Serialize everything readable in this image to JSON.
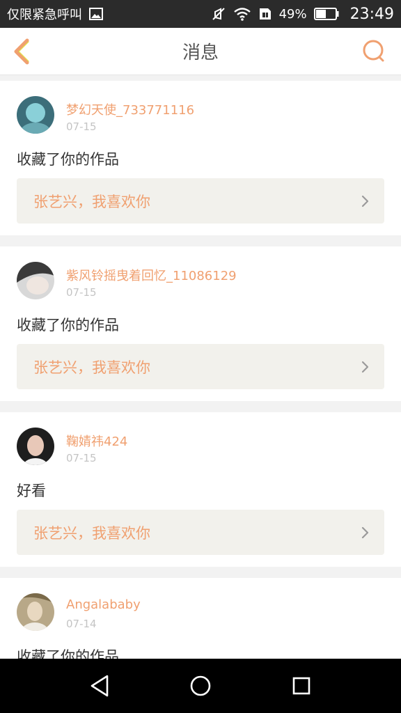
{
  "status_bar": {
    "carrier_text": "仅限紧急呼叫",
    "battery_percent": "49%",
    "time": "23:49",
    "icons": [
      "image-icon",
      "mute-icon",
      "wifi-icon",
      "sim-icon",
      "battery-icon"
    ]
  },
  "header": {
    "title": "消息",
    "back_icon": "chevron-left-icon",
    "search_icon": "search-icon",
    "accent_color": "#f0a070"
  },
  "messages": [
    {
      "username": "梦幻天使_733771116",
      "date": "07-15",
      "action": "收藏了你的作品",
      "work_title": "张艺兴，我喜欢你",
      "avatar_colors": [
        "#3c6e7a",
        "#8ad0d8"
      ]
    },
    {
      "username": "紫风铃摇曳着回忆_11086129",
      "date": "07-15",
      "action": "收藏了你的作品",
      "work_title": "张艺兴，我喜欢你",
      "avatar_colors": [
        "#3a3a3a",
        "#d8d8d8"
      ]
    },
    {
      "username": "鞠婧祎424",
      "date": "07-15",
      "action": "好看",
      "work_title": "张艺兴，我喜欢你",
      "avatar_colors": [
        "#1e1e1e",
        "#e8c8b8"
      ]
    },
    {
      "username": "Angalababy",
      "date": "07-14",
      "action": "收藏了你的作品",
      "work_title": "",
      "avatar_colors": [
        "#7a6a4a",
        "#e8d8c0"
      ]
    }
  ],
  "nav_bar": {
    "icons": [
      "back-triangle-icon",
      "home-circle-icon",
      "recents-square-icon"
    ]
  }
}
